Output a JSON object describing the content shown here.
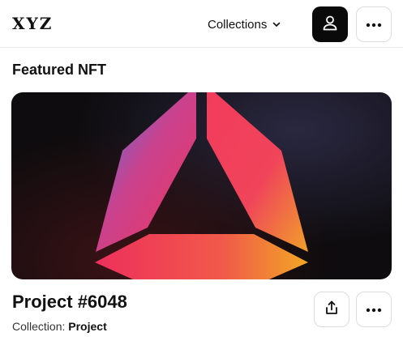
{
  "header": {
    "logo": "XYZ",
    "collections_label": "Collections",
    "collections_icon": "chevron-down-icon",
    "profile_icon": "user-icon",
    "more_icon": "more-horizontal-icon"
  },
  "section": {
    "title": "Featured NFT"
  },
  "nft": {
    "title": "Project #6048",
    "collection_prefix": "Collection: ",
    "collection_name": "Project",
    "share_icon": "share-icon",
    "more_icon": "more-horizontal-icon"
  },
  "colors": {
    "profile_button_bg": "#0a0a0a",
    "artwork_gradient": [
      "#5b6fd6",
      "#e8334e",
      "#f5a623"
    ]
  }
}
